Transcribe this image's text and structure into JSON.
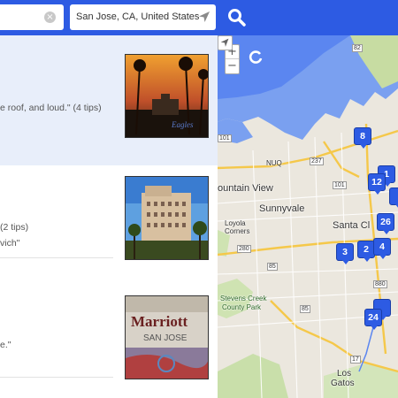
{
  "search": {
    "location_value": "San Jose, CA, United States",
    "clear_symbol": "×",
    "accent": "#2d5be3"
  },
  "results": [
    {
      "tip_lines": [
        "e roof, and loud.\" (4 tips)"
      ],
      "highlighted": true,
      "thumb": "hotel-california-album-art"
    },
    {
      "tip_lines": [
        "(2 tips)",
        "vich\""
      ],
      "highlighted": false,
      "thumb": "hotel-tower-photo"
    },
    {
      "tip_lines": [
        "e.\""
      ],
      "highlighted": false,
      "thumb": "marriott-san-jose-lobby"
    }
  ],
  "thumb_text": {
    "marriott_sign": "Marriott",
    "marriott_city": "SAN JOSE"
  },
  "map": {
    "zoom_in": "+",
    "zoom_out": "−",
    "labels": {
      "mountain_view": "ountain View",
      "sunnyvale": "Sunnyvale",
      "santa_clara": "Santa Cl",
      "loyola": "Loyola",
      "corners": "Corners",
      "stevens_creek": "Stevens Creek",
      "county_park": "County Park",
      "los": "Los",
      "gatos": "Gatos",
      "nuq": "NUQ"
    },
    "road_shields": [
      "101",
      "237",
      "101",
      "280",
      "85",
      "85",
      "17",
      "880",
      "82"
    ],
    "pins": [
      "8",
      "1",
      "12",
      "26",
      "3",
      "2",
      "4",
      "24"
    ]
  }
}
